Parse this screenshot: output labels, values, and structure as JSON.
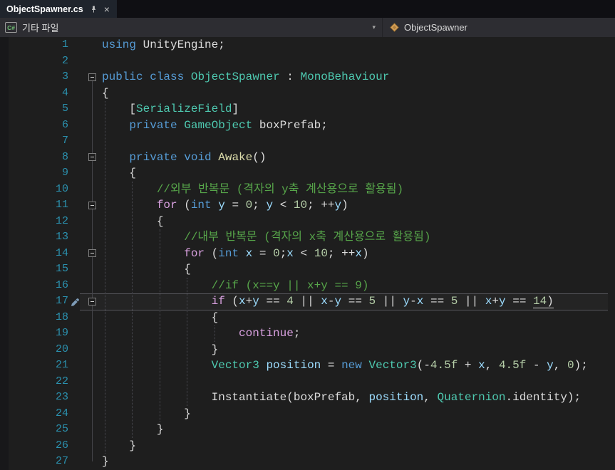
{
  "tab": {
    "title": "ObjectSpawner.cs"
  },
  "icons": {
    "close": "×",
    "chevron": "▾",
    "pin": "pin-icon",
    "csharp_file": "csharp-file-icon",
    "class": "class-icon",
    "line17_glyph": "pen-cursor-icon"
  },
  "navbar": {
    "project": "기타 파일",
    "member": "ObjectSpawner",
    "file_icon_text": "C#"
  },
  "theme": {
    "bg": "#1E1E1E",
    "marginBg": "#18181A",
    "tabStrip": "#0F0F13",
    "tabBg": "#1F242C",
    "tabText": "#FFFFFF",
    "navBg": "#2D2D32",
    "navText": "#D8D8D8",
    "lineNum": "#2B91AF",
    "pl": "#DCDCDC",
    "kw": "#569CD6",
    "ctrl": "#D8A0DF",
    "ty": "#4EC9B0",
    "fn": "#DCDCAA",
    "lo": "#9CDCFE",
    "nu": "#B5CEA8",
    "cm": "#57A64A",
    "guide": "#4A4A52",
    "classIconFill": "#D9A35C"
  },
  "editor": {
    "lines": [
      {
        "n": 1,
        "tokens": [
          [
            "kw",
            "using"
          ],
          [
            "pl",
            " UnityEngine;"
          ]
        ]
      },
      {
        "n": 2,
        "tokens": []
      },
      {
        "n": 3,
        "fold": true,
        "tokens": [
          [
            "kw",
            "public"
          ],
          [
            "pl",
            " "
          ],
          [
            "kw",
            "class"
          ],
          [
            "pl",
            " "
          ],
          [
            "ty",
            "ObjectSpawner"
          ],
          [
            "pl",
            " : "
          ],
          [
            "ty",
            "MonoBehaviour"
          ]
        ]
      },
      {
        "n": 4,
        "tokens": [
          [
            "pl",
            "{"
          ]
        ]
      },
      {
        "n": 5,
        "tokens": [
          [
            "pl",
            "    ["
          ],
          [
            "ty",
            "SerializeField"
          ],
          [
            "pl",
            "]"
          ]
        ]
      },
      {
        "n": 6,
        "tokens": [
          [
            "pl",
            "    "
          ],
          [
            "kw",
            "private"
          ],
          [
            "pl",
            " "
          ],
          [
            "ty",
            "GameObject"
          ],
          [
            "pl",
            " boxPrefab;"
          ]
        ]
      },
      {
        "n": 7,
        "tokens": []
      },
      {
        "n": 8,
        "fold": true,
        "tokens": [
          [
            "pl",
            "    "
          ],
          [
            "kw",
            "private"
          ],
          [
            "pl",
            " "
          ],
          [
            "kw",
            "void"
          ],
          [
            "pl",
            " "
          ],
          [
            "fn",
            "Awake"
          ],
          [
            "pl",
            "()"
          ]
        ]
      },
      {
        "n": 9,
        "tokens": [
          [
            "pl",
            "    {"
          ]
        ]
      },
      {
        "n": 10,
        "tokens": [
          [
            "pl",
            "        "
          ],
          [
            "cm",
            "//외부 반복문 (격자의 y축 계산용으로 활용됨)"
          ]
        ]
      },
      {
        "n": 11,
        "fold": true,
        "tokens": [
          [
            "pl",
            "        "
          ],
          [
            "ctrl",
            "for"
          ],
          [
            "pl",
            " ("
          ],
          [
            "kw",
            "int"
          ],
          [
            "pl",
            " "
          ],
          [
            "lo",
            "y"
          ],
          [
            "pl",
            " = "
          ],
          [
            "nu",
            "0"
          ],
          [
            "pl",
            "; "
          ],
          [
            "lo",
            "y"
          ],
          [
            "pl",
            " < "
          ],
          [
            "nu",
            "10"
          ],
          [
            "pl",
            "; ++"
          ],
          [
            "lo",
            "y"
          ],
          [
            "pl",
            ")"
          ]
        ]
      },
      {
        "n": 12,
        "tokens": [
          [
            "pl",
            "        {"
          ]
        ]
      },
      {
        "n": 13,
        "tokens": [
          [
            "pl",
            "            "
          ],
          [
            "cm",
            "//내부 반복문 (격자의 x축 계산용으로 활용됨)"
          ]
        ]
      },
      {
        "n": 14,
        "fold": true,
        "tokens": [
          [
            "pl",
            "            "
          ],
          [
            "ctrl",
            "for"
          ],
          [
            "pl",
            " ("
          ],
          [
            "kw",
            "int"
          ],
          [
            "pl",
            " "
          ],
          [
            "lo",
            "x"
          ],
          [
            "pl",
            " = "
          ],
          [
            "nu",
            "0"
          ],
          [
            "pl",
            ";"
          ],
          [
            "lo",
            "x"
          ],
          [
            "pl",
            " < "
          ],
          [
            "nu",
            "10"
          ],
          [
            "pl",
            "; ++"
          ],
          [
            "lo",
            "x"
          ],
          [
            "pl",
            ")"
          ]
        ]
      },
      {
        "n": 15,
        "tokens": [
          [
            "pl",
            "            {"
          ]
        ]
      },
      {
        "n": 16,
        "tokens": [
          [
            "pl",
            "                "
          ],
          [
            "cm",
            "//if (x==y || x+y == 9)"
          ]
        ]
      },
      {
        "n": 17,
        "fold": true,
        "current": true,
        "icon": "pen",
        "tokens": [
          [
            "pl",
            "                "
          ],
          [
            "ctrl",
            "if"
          ],
          [
            "pl",
            " ("
          ],
          [
            "lo",
            "x"
          ],
          [
            "pl",
            "+"
          ],
          [
            "lo",
            "y"
          ],
          [
            "pl",
            " == "
          ],
          [
            "nu",
            "4"
          ],
          [
            "pl",
            " || "
          ],
          [
            "lo",
            "x"
          ],
          [
            "pl",
            "-"
          ],
          [
            "lo",
            "y"
          ],
          [
            "pl",
            " == "
          ],
          [
            "nu",
            "5"
          ],
          [
            "pl",
            " || "
          ],
          [
            "lo",
            "y"
          ],
          [
            "pl",
            "-"
          ],
          [
            "lo",
            "x"
          ],
          [
            "pl",
            " == "
          ],
          [
            "nu",
            "5"
          ],
          [
            "pl",
            " || "
          ],
          [
            "lo",
            "x"
          ],
          [
            "pl",
            "+"
          ],
          [
            "lo",
            "y"
          ],
          [
            "pl",
            " == "
          ],
          [
            "nu",
            "14",
            "ul"
          ],
          [
            "pl",
            ")",
            "ul"
          ]
        ]
      },
      {
        "n": 18,
        "tokens": [
          [
            "pl",
            "                {"
          ]
        ]
      },
      {
        "n": 19,
        "tokens": [
          [
            "pl",
            "                    "
          ],
          [
            "ctrl",
            "continue"
          ],
          [
            "pl",
            ";"
          ]
        ]
      },
      {
        "n": 20,
        "tokens": [
          [
            "pl",
            "                }"
          ]
        ]
      },
      {
        "n": 21,
        "tokens": [
          [
            "pl",
            "                "
          ],
          [
            "ty",
            "Vector3"
          ],
          [
            "pl",
            " "
          ],
          [
            "lo",
            "position"
          ],
          [
            "pl",
            " = "
          ],
          [
            "kw",
            "new"
          ],
          [
            "pl",
            " "
          ],
          [
            "ty",
            "Vector3"
          ],
          [
            "pl",
            "(-"
          ],
          [
            "nu",
            "4.5f"
          ],
          [
            "pl",
            " + "
          ],
          [
            "lo",
            "x"
          ],
          [
            "pl",
            ", "
          ],
          [
            "nu",
            "4.5f"
          ],
          [
            "pl",
            " - "
          ],
          [
            "lo",
            "y"
          ],
          [
            "pl",
            ", "
          ],
          [
            "nu",
            "0"
          ],
          [
            "pl",
            ");"
          ]
        ]
      },
      {
        "n": 22,
        "tokens": []
      },
      {
        "n": 23,
        "tokens": [
          [
            "pl",
            "                Instantiate(boxPrefab, "
          ],
          [
            "lo",
            "position"
          ],
          [
            "pl",
            ", "
          ],
          [
            "ty",
            "Quaternion"
          ],
          [
            "pl",
            ".identity);"
          ]
        ]
      },
      {
        "n": 24,
        "tokens": [
          [
            "pl",
            "            }"
          ]
        ]
      },
      {
        "n": 25,
        "tokens": [
          [
            "pl",
            "        }"
          ]
        ]
      },
      {
        "n": 26,
        "tokens": [
          [
            "pl",
            "    }"
          ]
        ]
      },
      {
        "n": 27,
        "tokens": [
          [
            "pl",
            "}"
          ]
        ]
      }
    ],
    "guides": [
      {
        "col": 0,
        "from": 5,
        "to": 26
      },
      {
        "col": 4,
        "from": 10,
        "to": 25
      },
      {
        "col": 8,
        "from": 13,
        "to": 24
      },
      {
        "col": 12,
        "from": 16,
        "to": 23
      },
      {
        "col": 16,
        "from": 19,
        "to": 19
      }
    ],
    "fold_line": {
      "from": 3,
      "to": 27
    }
  }
}
